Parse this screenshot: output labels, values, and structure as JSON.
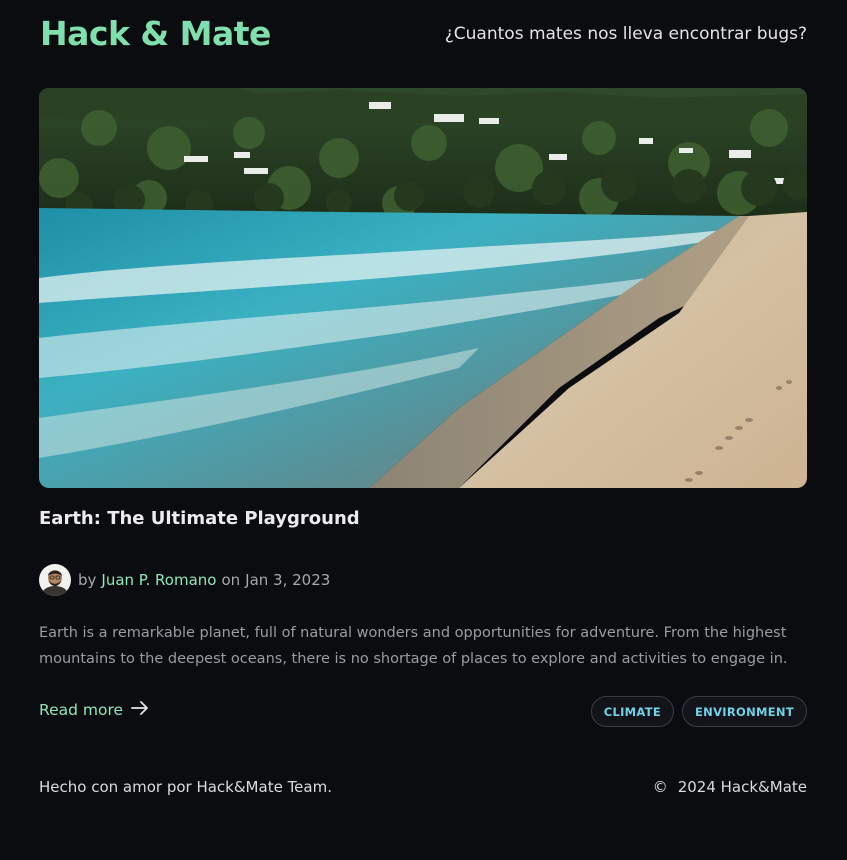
{
  "header": {
    "brand": "Hack & Mate",
    "tagline": "¿Cuantos mates nos lleva encontrar bugs?"
  },
  "post": {
    "title": "Earth: The Ultimate Playground",
    "by": "by",
    "author": "Juan P. Romano",
    "date_prefix": "on",
    "date": "Jan 3, 2023",
    "excerpt": "Earth is a remarkable planet, full of natural wonders and opportunities for adventure. From the highest mountains to the deepest oceans, there is no shortage of places to explore and activities to engage in.",
    "read_more": "Read more",
    "tags": [
      "CLIMATE",
      "ENVIRONMENT"
    ]
  },
  "footer": {
    "left": "Hecho con amor por Hack&Mate Team.",
    "copyright_symbol": "©",
    "right": "2024 Hack&Mate"
  },
  "colors": {
    "background": "#0b0c0f",
    "accent": "#7fe0ae",
    "tag_text": "#6fd2e6"
  }
}
